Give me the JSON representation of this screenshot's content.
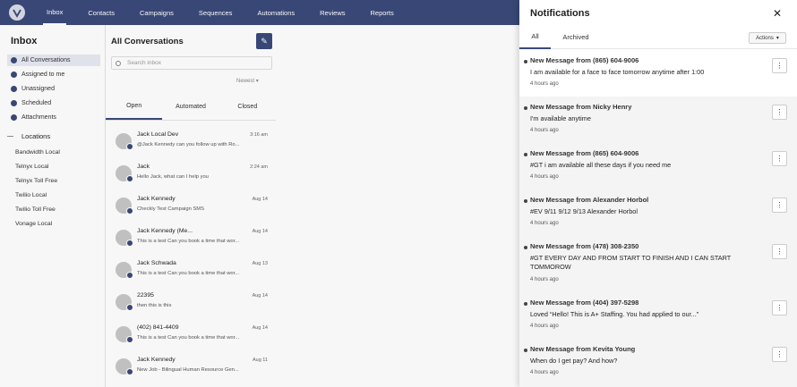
{
  "nav": {
    "items": [
      "Inbox",
      "Contacts",
      "Campaigns",
      "Sequences",
      "Automations",
      "Reviews",
      "Reports"
    ]
  },
  "sidebar": {
    "title": "Inbox",
    "items": [
      {
        "label": "All Conversations"
      },
      {
        "label": "Assigned to me"
      },
      {
        "label": "Unassigned"
      },
      {
        "label": "Scheduled"
      },
      {
        "label": "Attachments"
      }
    ],
    "section_label": "Locations",
    "locations": [
      "Bandwidth Local",
      "Telnyx Local",
      "Telnyx Toll Free",
      "Twilio Local",
      "Twilio Toll Free",
      "Vonage Local"
    ]
  },
  "conversations": {
    "title": "All Conversations",
    "search_placeholder": "Search inbox",
    "sort_label": "Newest",
    "tabs": [
      "Open",
      "Automated",
      "Closed"
    ],
    "items": [
      {
        "name": "Jack Local Dev",
        "time": "3:16 am",
        "preview": "@Jack Kennedy can you follow up with Ro..."
      },
      {
        "name": "Jack",
        "time": "2:24 am",
        "preview": "Hello Jack, what can I help you"
      },
      {
        "name": "Jack Kennedy",
        "time": "Aug 14",
        "preview": "Checkly Test Campaign SMS"
      },
      {
        "name": "Jack Kennedy (Me...",
        "time": "Aug 14",
        "preview": "This is a test Can you book a time that wor..."
      },
      {
        "name": "Jack Schwada",
        "time": "Aug 13",
        "preview": "This is a test Can you book a time that wor..."
      },
      {
        "name": "22395",
        "time": "Aug 14",
        "preview": "then this is this"
      },
      {
        "name": "(402) 841-4409",
        "time": "Aug 14",
        "preview": "This is a test Can you book a time that wor..."
      },
      {
        "name": "Jack Kennedy",
        "time": "Aug 11",
        "preview": "New Job - Bilingual Human Resource Gen..."
      }
    ]
  },
  "notifications": {
    "title": "Notifications",
    "tabs": [
      "All",
      "Archived"
    ],
    "actions_label": "Actions",
    "items": [
      {
        "title": "New Message from (865) 604-9006",
        "body": "I am available for a face to face tomorrow anytime after 1:00",
        "time": "4 hours ago"
      },
      {
        "title": "New Message from Nicky Henry",
        "body": "I'm available anytime",
        "time": "4 hours ago"
      },
      {
        "title": "New Message from (865) 604-9006",
        "body": "#GT i am available all these days if you need me",
        "time": "4 hours ago"
      },
      {
        "title": "New Message from Alexander Horbol",
        "body": "#EV 9/11 9/12 9/13 Alexander Horbol",
        "time": "4 hours ago"
      },
      {
        "title": "New Message from (478) 308-2350",
        "body": "#GT EVERY DAY AND FROM START TO FINISH AND I CAN START TOMMOROW",
        "time": "4 hours ago"
      },
      {
        "title": "New Message from (404) 397-5298",
        "body": "Loved “Hello! This is A+ Staffing. You had applied to our...”",
        "time": "4 hours ago"
      },
      {
        "title": "New Message from Kevita Young",
        "body": "When do I get pay? And how?",
        "time": "4 hours ago"
      }
    ]
  },
  "colors": {
    "brand": "#3b4a7a"
  }
}
